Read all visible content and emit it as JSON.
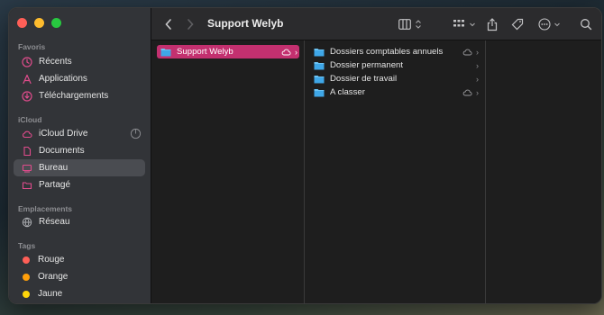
{
  "window": {
    "title": "Support Welyb"
  },
  "sidebar": {
    "sections": {
      "favorites": "Favoris",
      "icloud": "iCloud",
      "locations": "Emplacements",
      "tags": "Tags"
    },
    "favorites": [
      {
        "label": "Récents",
        "icon": "clock-icon"
      },
      {
        "label": "Applications",
        "icon": "applications-icon"
      },
      {
        "label": "Téléchargements",
        "icon": "download-icon"
      }
    ],
    "icloud": [
      {
        "label": "iCloud Drive",
        "icon": "cloud-icon"
      },
      {
        "label": "Documents",
        "icon": "document-icon"
      },
      {
        "label": "Bureau",
        "icon": "desktop-icon"
      },
      {
        "label": "Partagé",
        "icon": "shared-folder-icon"
      }
    ],
    "locations": [
      {
        "label": "Réseau",
        "icon": "network-icon"
      }
    ],
    "tags": [
      {
        "label": "Rouge",
        "color": "#ff5f57"
      },
      {
        "label": "Orange",
        "color": "#ff9f0a"
      },
      {
        "label": "Jaune",
        "color": "#ffd60a"
      }
    ],
    "selected": "Bureau"
  },
  "columns": {
    "col1": [
      {
        "label": "Support Welyb",
        "cloud": true,
        "selected": true
      }
    ],
    "col2": [
      {
        "label": "Dossiers comptables annuels",
        "cloud": true
      },
      {
        "label": "Dossier permanent",
        "cloud": false
      },
      {
        "label": "Dossier de travail",
        "cloud": false
      },
      {
        "label": "A classer",
        "cloud": true
      }
    ]
  },
  "colors": {
    "selection": "#c3306f",
    "sidebarSelection": "#4a4c51",
    "folder": "#3fa7e8"
  }
}
